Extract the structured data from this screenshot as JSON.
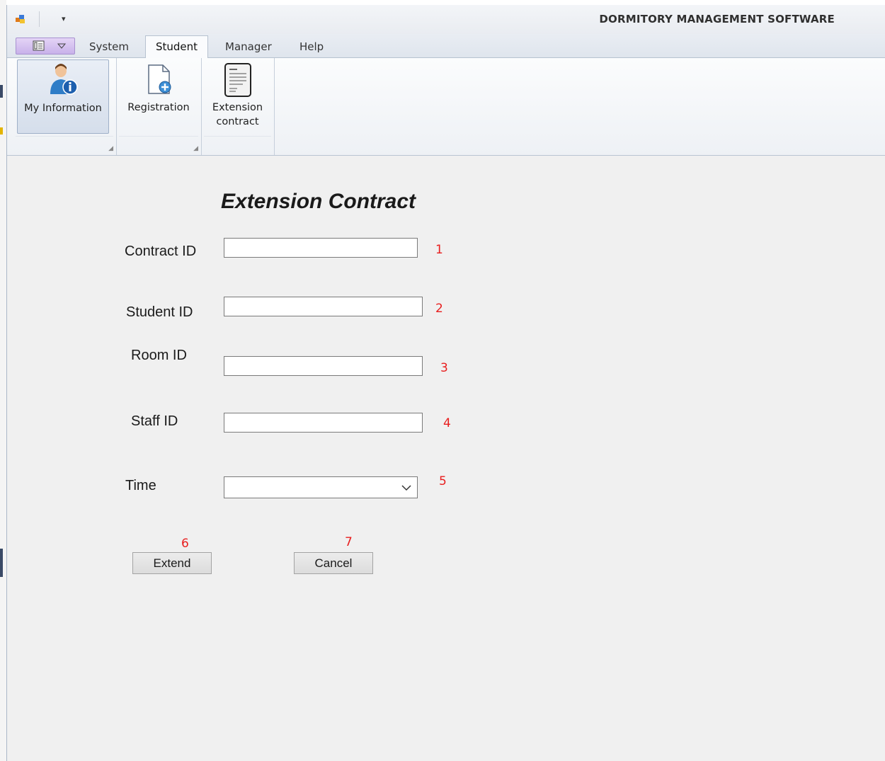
{
  "window": {
    "title": "DORMITORY MANAGEMENT SOFTWARE",
    "quick_access_arrow": "▾"
  },
  "ribbon": {
    "app_menu_icons": [
      "panel-icon",
      "chevron-down-icon"
    ],
    "tabs": [
      {
        "label": "System"
      },
      {
        "label": "Student",
        "active": true
      },
      {
        "label": "Manager"
      },
      {
        "label": "Help"
      }
    ],
    "buttons": [
      {
        "label": "My Information",
        "icon": "user-info-icon",
        "selected": true
      },
      {
        "label": "Registration",
        "icon": "document-add-icon"
      },
      {
        "label_line1": "Extension",
        "label_line2": "contract",
        "icon": "contract-document-icon"
      }
    ]
  },
  "form": {
    "title": "Extension Contract",
    "fields": [
      {
        "label": "Contract ID",
        "value": "",
        "marker": "1"
      },
      {
        "label": "Student ID",
        "value": "",
        "marker": "2"
      },
      {
        "label": "Room ID",
        "value": "",
        "marker": "3"
      },
      {
        "label": "Staff ID",
        "value": "",
        "marker": "4"
      },
      {
        "label": "Time",
        "value": "",
        "marker": "5"
      }
    ],
    "extend_button": {
      "label": "Extend",
      "marker": "6"
    },
    "cancel_button": {
      "label": "Cancel",
      "marker": "7"
    }
  },
  "colors": {
    "marker": "#e81e1e",
    "app_menu": "#c8b1ea",
    "window_bg": "#f0f0f0"
  }
}
